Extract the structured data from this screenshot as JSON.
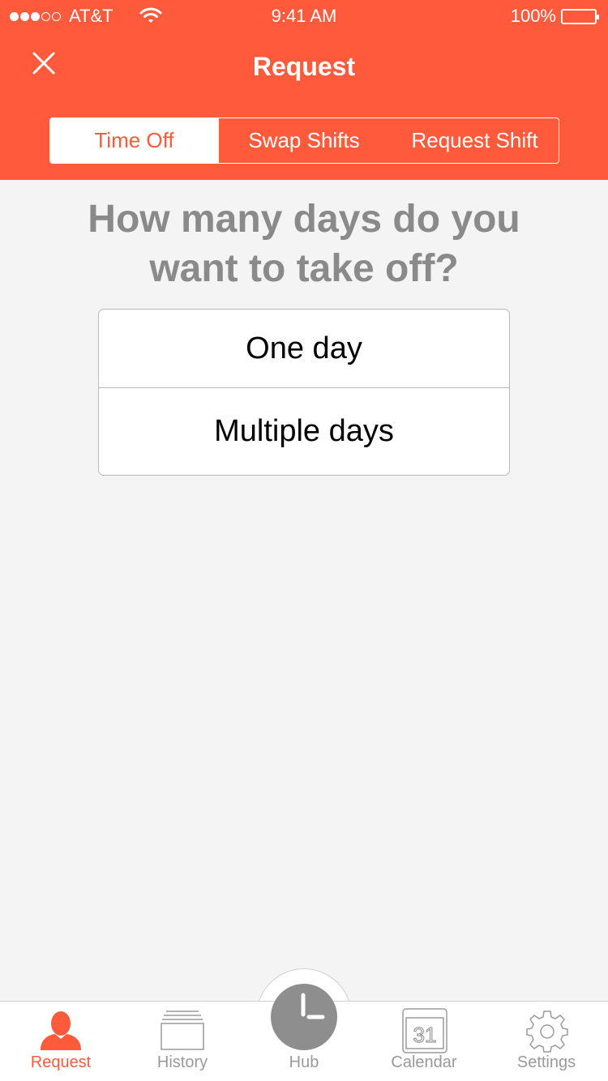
{
  "status_bar": {
    "carrier": "AT&T",
    "time": "9:41 AM",
    "battery": "100%"
  },
  "nav": {
    "title": "Request"
  },
  "segments": [
    {
      "label": "Time Off",
      "active": true
    },
    {
      "label": "Swap Shifts",
      "active": false
    },
    {
      "label": "Request Shift",
      "active": false
    }
  ],
  "question": "How many days do you want to take off?",
  "options": [
    {
      "label": "One day"
    },
    {
      "label": "Multiple days"
    }
  ],
  "tabs": [
    {
      "label": "Request",
      "icon": "person-icon",
      "active": true
    },
    {
      "label": "History",
      "icon": "history-stack-icon",
      "active": false
    },
    {
      "label": "Hub",
      "icon": "clock-icon",
      "active": false
    },
    {
      "label": "Calendar",
      "icon": "calendar-icon",
      "calendar_day": "31",
      "active": false
    },
    {
      "label": "Settings",
      "icon": "gear-icon",
      "active": false
    }
  ],
  "colors": {
    "accent": "#ff5a3c",
    "background": "#f4f4f4",
    "inactive_tab": "#9a9a9a"
  }
}
